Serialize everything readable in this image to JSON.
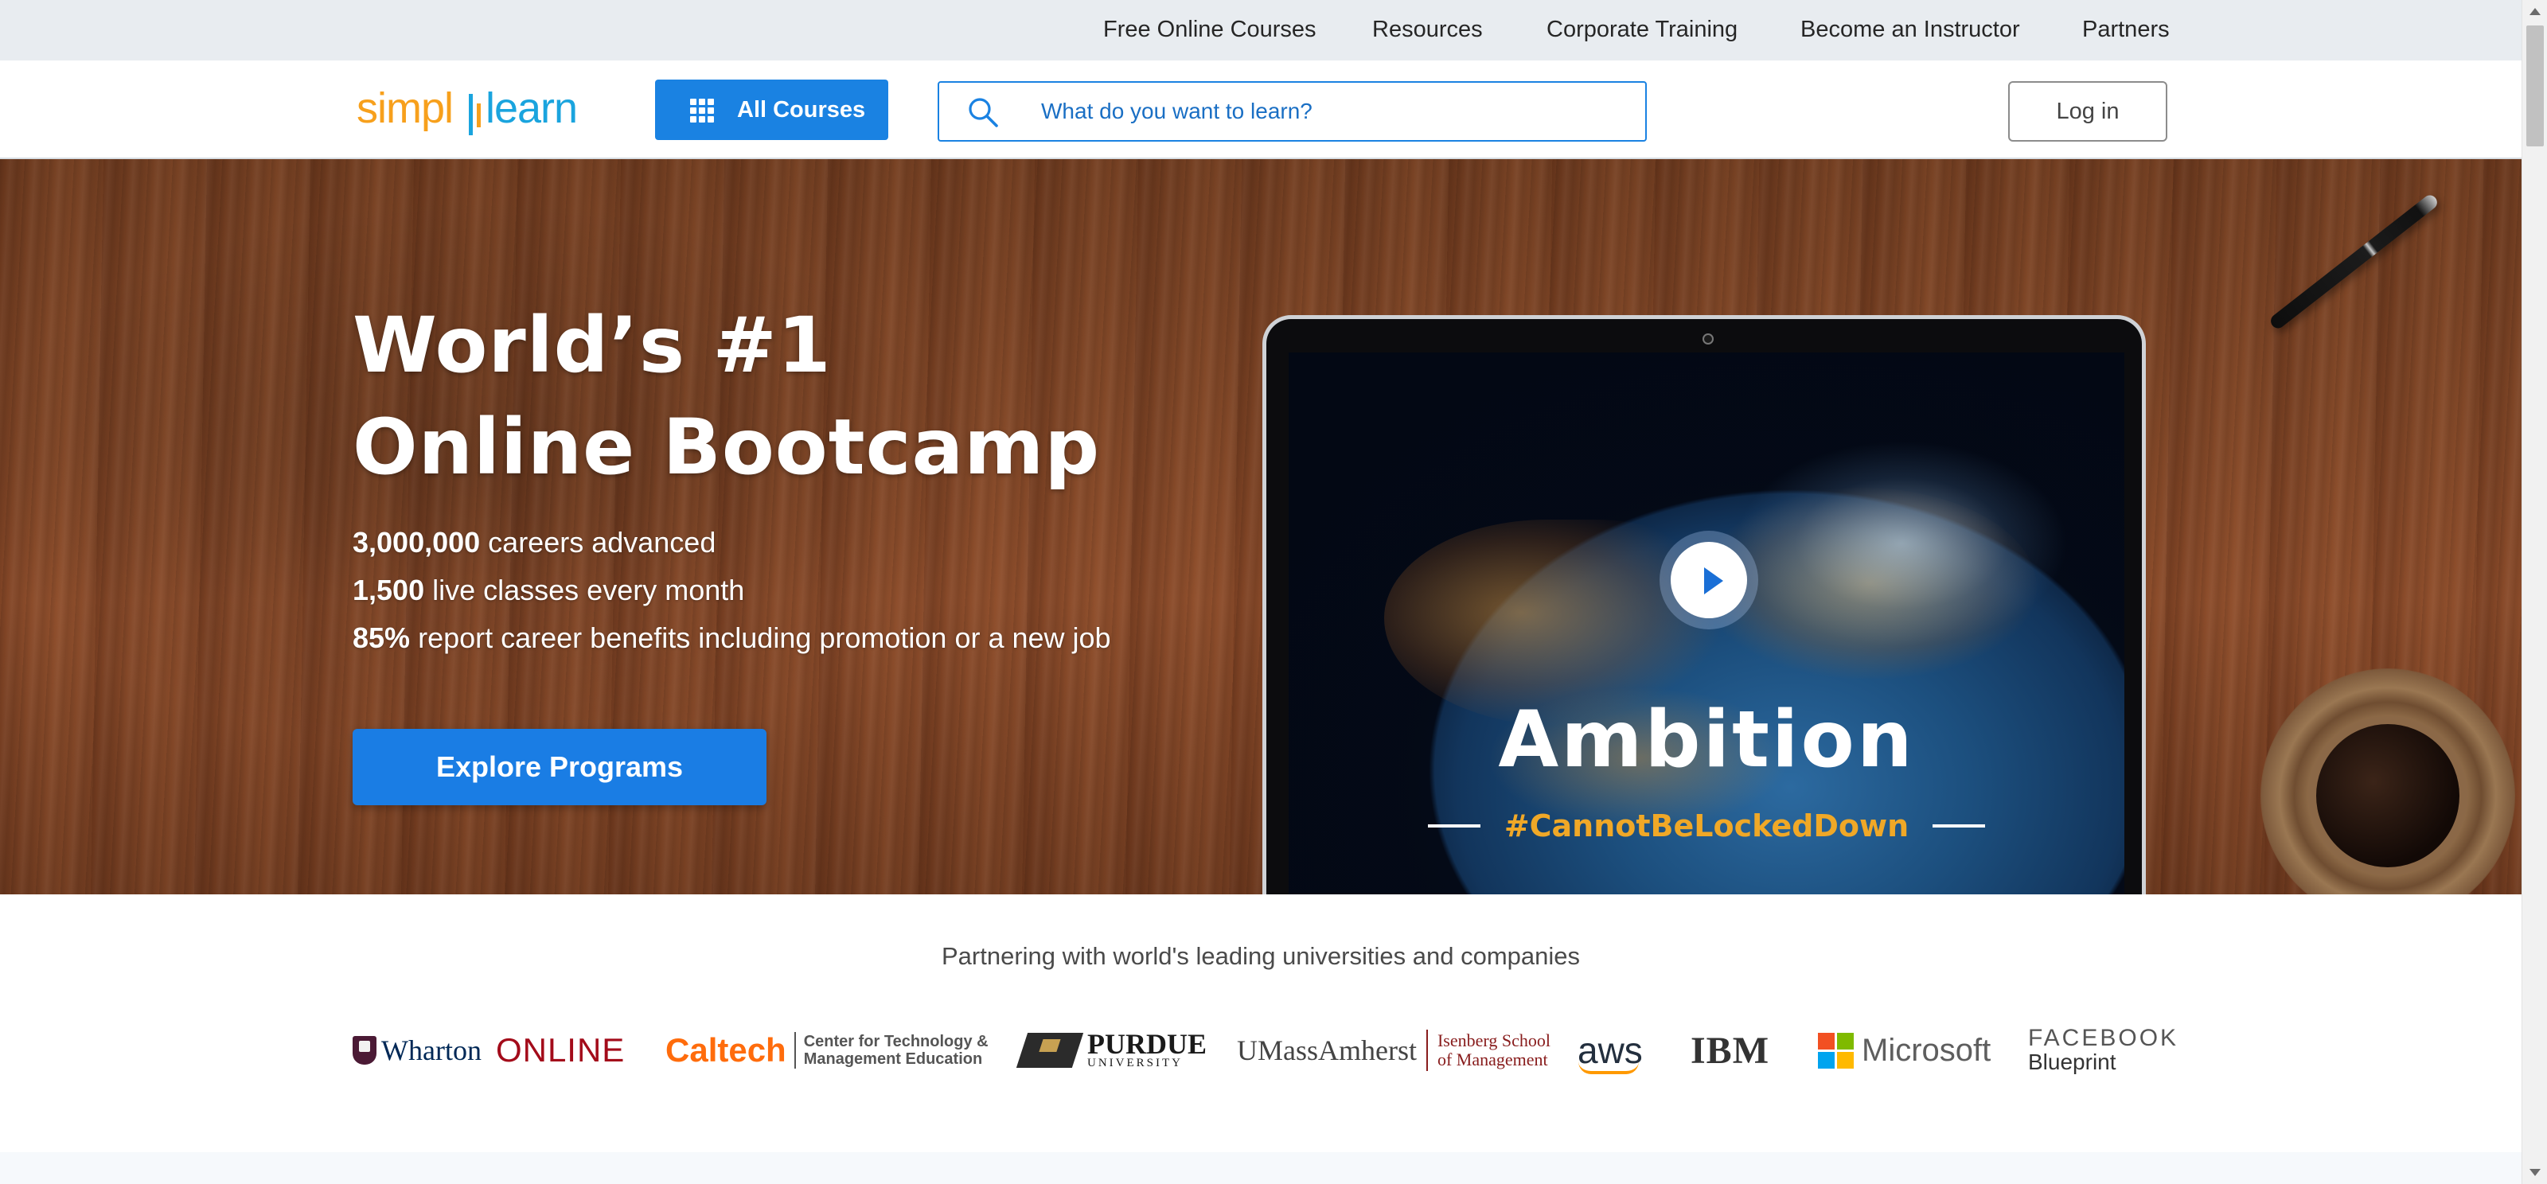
{
  "topnav": {
    "items": [
      {
        "label": "Free Online Courses"
      },
      {
        "label": "Resources"
      },
      {
        "label": "Corporate Training"
      },
      {
        "label": "Become an Instructor"
      },
      {
        "label": "Partners"
      }
    ]
  },
  "header": {
    "logo_text": "simplilearn",
    "all_courses_label": "All Courses",
    "all_courses_icon": "grid-icon",
    "search_placeholder": "What do you want to learn?",
    "search_icon": "search-icon",
    "login_label": "Log in"
  },
  "hero": {
    "title_line1": "World’s #1",
    "title_line2": "Online Bootcamp",
    "stats": [
      {
        "value": "3,000,000",
        "text": "careers advanced"
      },
      {
        "value": "1,500",
        "text": "live classes every month"
      },
      {
        "value": "85%",
        "text": "report career benefits including promotion or a new job"
      }
    ],
    "cta_label": "Explore Programs",
    "video": {
      "headline": "Ambition",
      "hashtag": "#CannotBeLockedDown",
      "play_icon": "play-icon"
    }
  },
  "partners": {
    "title": "Partnering with world's leading universities and companies",
    "logos": {
      "wharton_name": "Wharton",
      "wharton_online": "ONLINE",
      "caltech_name": "Caltech",
      "caltech_sub1": "Center for Technology &",
      "caltech_sub2": "Management Education",
      "purdue_name": "PURDUE",
      "purdue_sub": "UNIVERSITY",
      "umass_name": "UMassAmherst",
      "umass_sub1": "Isenberg School",
      "umass_sub2": "of Management",
      "aws": "aws",
      "ibm": "IBM",
      "microsoft": "Microsoft",
      "facebook_name": "FACEBOOK",
      "facebook_sub": "Blueprint"
    }
  },
  "colors": {
    "brand_blue": "#1a82e2",
    "logo_orange": "#f7a01c",
    "logo_blue": "#1aa4de",
    "hashtag_gold": "#f0a827"
  }
}
